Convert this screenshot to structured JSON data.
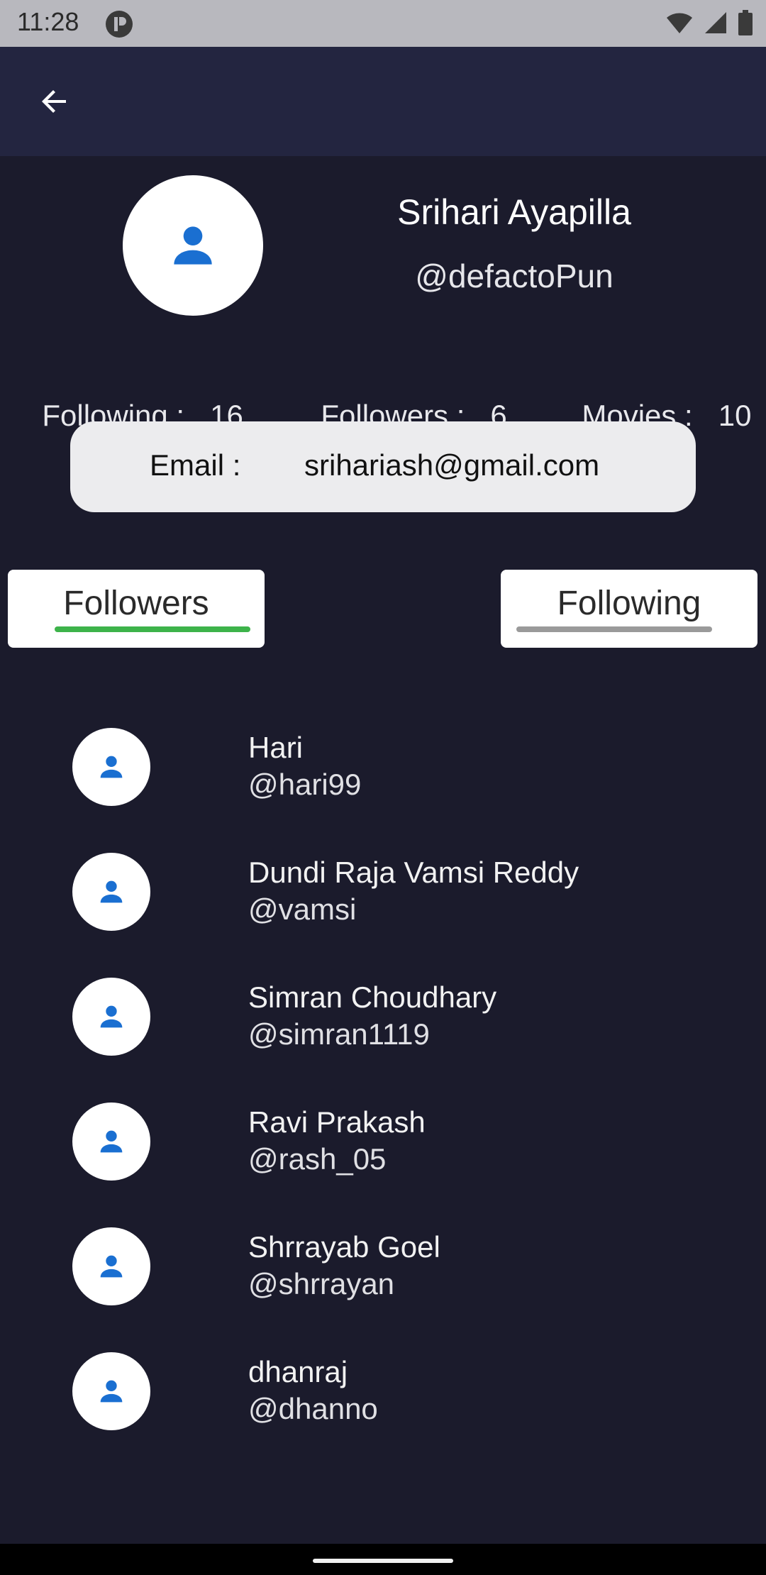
{
  "status_bar": {
    "time": "11:28"
  },
  "profile": {
    "name": "Srihari Ayapilla",
    "handle": "@defactoPun"
  },
  "stats": [
    {
      "label": "Following :",
      "value": "16"
    },
    {
      "label": "Followers :",
      "value": "6"
    },
    {
      "label": "Movies :",
      "value": "10"
    }
  ],
  "email": {
    "label": "Email :",
    "value": "srihariash@gmail.com"
  },
  "tabs": [
    {
      "label": "Followers",
      "active": true,
      "underline_color": "#3db34a"
    },
    {
      "label": "Following",
      "active": false,
      "underline_color": "#9a9a9a"
    }
  ],
  "users": [
    {
      "name": "Hari",
      "handle": "@hari99"
    },
    {
      "name": "Dundi Raja Vamsi Reddy",
      "handle": "@vamsi"
    },
    {
      "name": "Simran Choudhary",
      "handle": "@simran1119"
    },
    {
      "name": "Ravi Prakash",
      "handle": "@rash_05"
    },
    {
      "name": "Shrrayab Goel",
      "handle": "@shrrayan"
    },
    {
      "name": "dhanraj",
      "handle": "@dhanno"
    }
  ],
  "colors": {
    "background": "#1b1b2c",
    "app_bar": "#232540",
    "avatar_icon": "#1a6fd1"
  }
}
